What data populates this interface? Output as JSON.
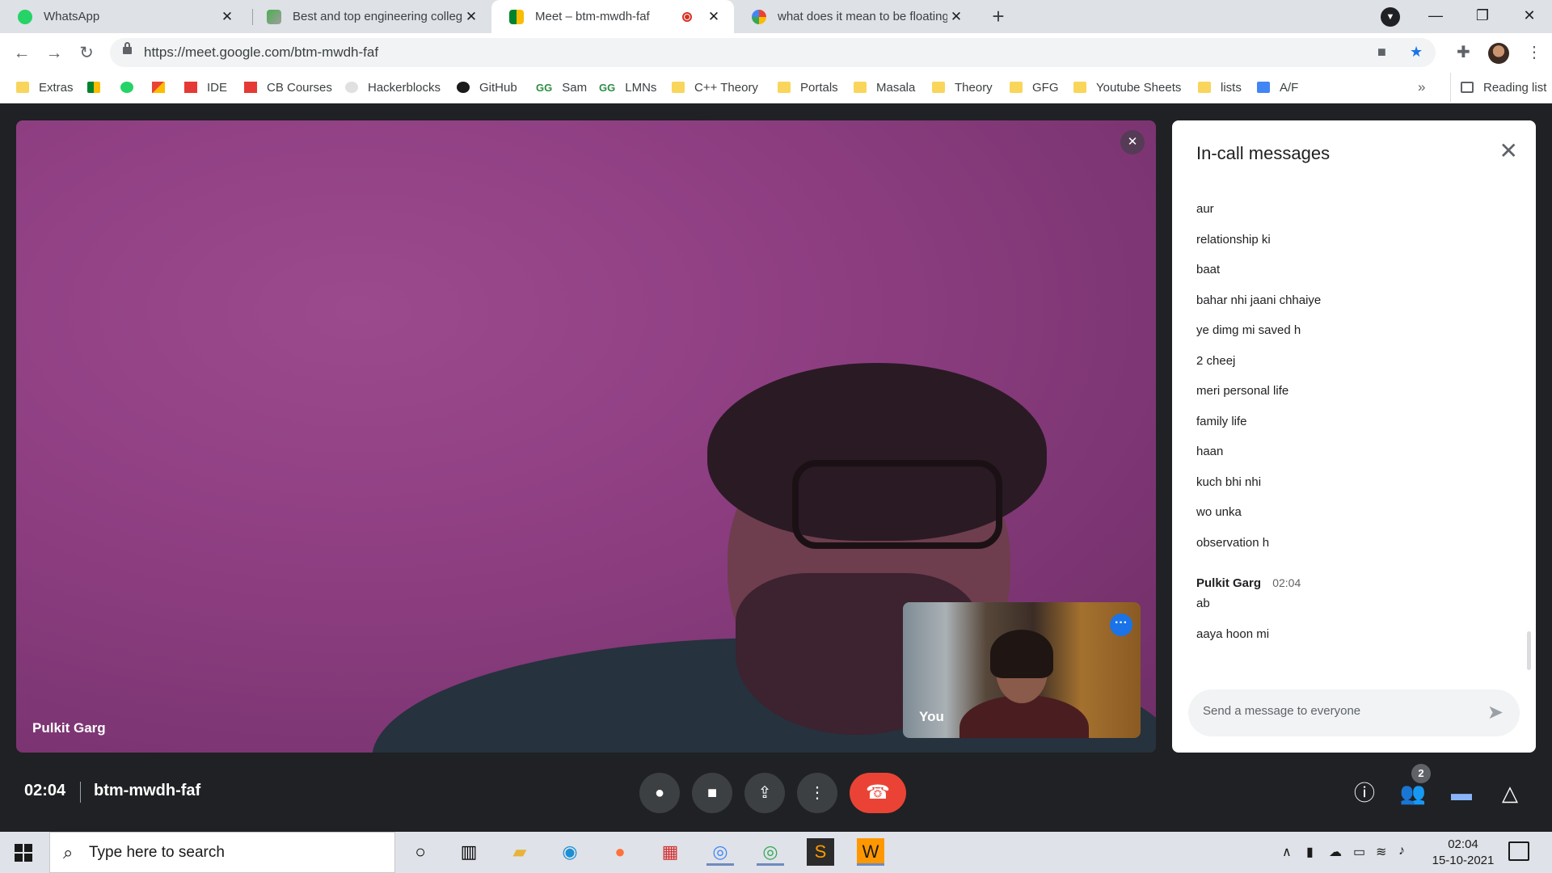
{
  "browser": {
    "tabs": [
      {
        "title": "WhatsApp",
        "active": false
      },
      {
        "title": "Best and top engineering college",
        "active": false
      },
      {
        "title": "Meet – btm-mwdh-faf",
        "active": true,
        "recording": true
      },
      {
        "title": "what does it mean to be floating",
        "active": false
      }
    ],
    "url": "https://meet.google.com/btm-mwdh-faf",
    "bookmarks": [
      {
        "label": "Extras",
        "icon": "folder-icon"
      },
      {
        "label": "",
        "icon": "meet-icon"
      },
      {
        "label": "",
        "icon": "whatsapp-icon"
      },
      {
        "label": "",
        "icon": "gmail-icon"
      },
      {
        "label": "IDE",
        "icon": "cb-icon"
      },
      {
        "label": "CB Courses",
        "icon": "cb-icon"
      },
      {
        "label": "Hackerblocks",
        "icon": "hackerblocks-icon"
      },
      {
        "label": "GitHub",
        "icon": "github-icon"
      },
      {
        "label": "Sam",
        "icon": "gfg-icon"
      },
      {
        "label": "LMNs",
        "icon": "gfg-icon"
      },
      {
        "label": "C++ Theory",
        "icon": "folder-icon"
      },
      {
        "label": "Portals",
        "icon": "folder-icon"
      },
      {
        "label": "Masala",
        "icon": "folder-icon"
      },
      {
        "label": "Theory",
        "icon": "folder-icon"
      },
      {
        "label": "GFG",
        "icon": "folder-icon"
      },
      {
        "label": "Youtube Sheets",
        "icon": "folder-icon"
      },
      {
        "label": "lists",
        "icon": "folder-icon"
      },
      {
        "label": "A/F",
        "icon": "docs-icon"
      }
    ],
    "more_bookmarks": "»",
    "reading_list": "Reading list"
  },
  "meet": {
    "main_participant": "Pulkit Garg",
    "self_label": "You",
    "chat": {
      "title": "In-call messages",
      "messages": [
        "aur",
        "relationship ki",
        "baat",
        "bahar nhi jaani chhaiye",
        "ye dimg mi saved h",
        "2 cheej",
        "meri personal life",
        "family life",
        "haan",
        "kuch bhi nhi",
        "wo unka",
        "observation h"
      ],
      "last_group": {
        "sender": "Pulkit Garg",
        "time": "02:04",
        "messages": [
          "ab",
          "aaya hoon mi"
        ]
      },
      "input_placeholder": "Send a message to everyone"
    },
    "call_time": "02:04",
    "meeting_code": "btm-mwdh-faf",
    "participant_count": "2",
    "end_call_color": "#ea4335",
    "accent_color": "#1a73e8"
  },
  "taskbar": {
    "search_placeholder": "Type here to search",
    "time": "02:04",
    "date": "15-10-2021"
  }
}
